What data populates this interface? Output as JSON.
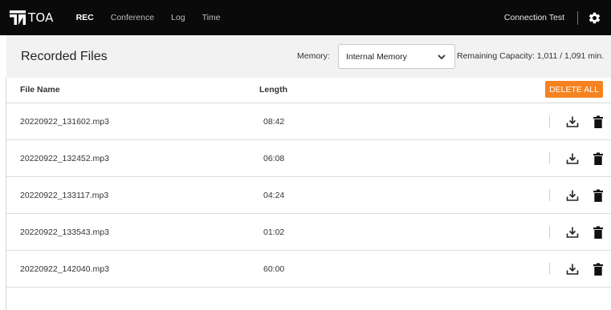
{
  "app": {
    "logo_text": "TOA"
  },
  "nav": {
    "items": [
      {
        "label": "REC",
        "active": true
      },
      {
        "label": "Conference",
        "active": false
      },
      {
        "label": "Log",
        "active": false
      },
      {
        "label": "Time",
        "active": false
      }
    ],
    "connection_test": "Connection Test",
    "settings_icon": "gear-icon"
  },
  "header": {
    "title": "Recorded Files",
    "memory_label": "Memory:",
    "memory_select": {
      "value": "Internal Memory",
      "icon": "chevron-down-icon"
    },
    "capacity": "Remaining Capacity: 1,011 / 1,091 min."
  },
  "table": {
    "columns": [
      "File Name",
      "Length"
    ],
    "delete_all_label": "DELETE ALL",
    "rows": [
      {
        "file": "20220922_131602.mp3",
        "length": "08:42"
      },
      {
        "file": "20220922_132452.mp3",
        "length": "06:08"
      },
      {
        "file": "20220922_133117.mp3",
        "length": "04:24"
      },
      {
        "file": "20220922_133543.mp3",
        "length": "01:02"
      },
      {
        "file": "20220922_142040.mp3",
        "length": "60:00"
      }
    ],
    "row_icons": [
      "download-icon",
      "trash-icon"
    ]
  },
  "colors": {
    "topbar": "#0a0a0a",
    "accent": "#f58220",
    "subheader": "#f2f2f2"
  }
}
